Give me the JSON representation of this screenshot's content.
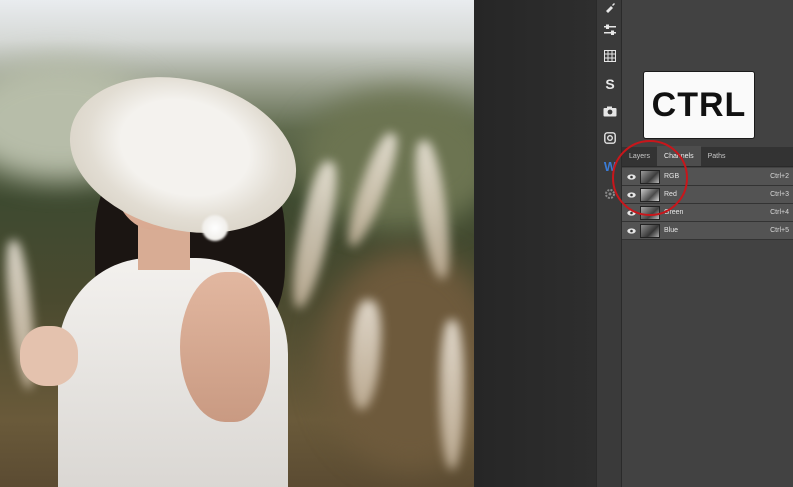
{
  "overlay": {
    "key_label": "CTRL"
  },
  "tools": {
    "items": [
      {
        "icon": "brush-icon"
      },
      {
        "icon": "adjust-sliders-icon"
      },
      {
        "icon": "grid-icon"
      },
      {
        "icon": "s-icon",
        "glyph": "S"
      },
      {
        "icon": "camera-icon"
      },
      {
        "icon": "instagram-icon"
      },
      {
        "icon": "w-icon",
        "glyph": "W"
      },
      {
        "icon": "gear-icon"
      }
    ]
  },
  "panel": {
    "tabs": [
      {
        "label": "Layers",
        "active": false
      },
      {
        "label": "Channels",
        "active": true
      },
      {
        "label": "Paths",
        "active": false
      }
    ],
    "channels": [
      {
        "name": "RGB",
        "shortcut": "Ctrl+2",
        "visible": true
      },
      {
        "name": "Red",
        "shortcut": "Ctrl+3",
        "visible": true
      },
      {
        "name": "Green",
        "shortcut": "Ctrl+4",
        "visible": true
      },
      {
        "name": "Blue",
        "shortcut": "Ctrl+5",
        "visible": true
      }
    ]
  },
  "colors": {
    "highlight_circle": "#c8161b",
    "w_icon": "#3a7bd5"
  }
}
